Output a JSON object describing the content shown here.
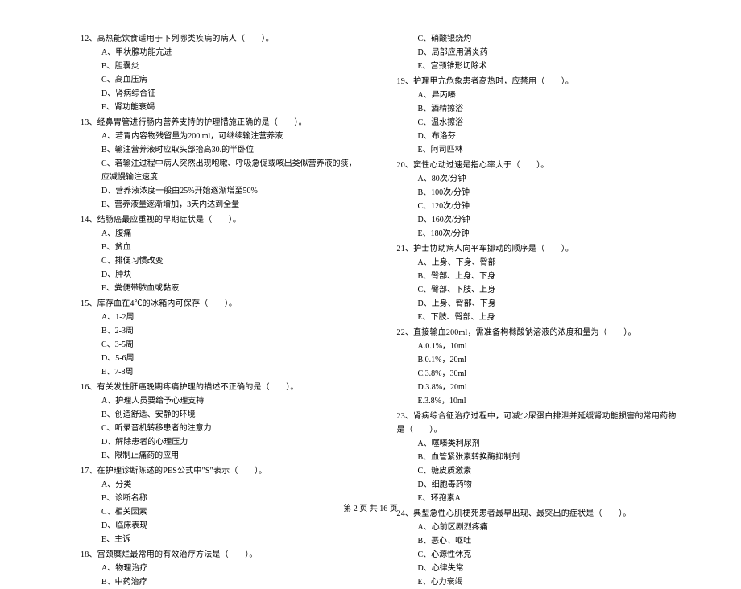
{
  "left": [
    {
      "n": "12、",
      "t": "高热能饮食适用于下列哪类疾病的病人（　　）。",
      "o": [
        "A、甲状腺功能亢进",
        "B、胆囊炎",
        "C、高血压病",
        "D、肾病综合征",
        "E、肾功能衰竭"
      ]
    },
    {
      "n": "13、",
      "t": "经鼻胃管进行肠内营养支持的护理措施正确的是（　　）。",
      "o": [
        "A、若胃内容物残留量为200 ml，可继续输注营养液",
        "B、输注营养液时应取头部抬高30.的半卧位",
        "C、若输注过程中病人突然出现咆嗽、呼吸急促或咳出类似营养液的痰，应减慢输注速度",
        "D、营养液浓度一般由25%开始逐渐增至50%",
        "E、营养液量逐渐增加，3天内达到全量"
      ]
    },
    {
      "n": "14、",
      "t": "结肠癌最应重视的早期症状是（　　）。",
      "o": [
        "A、腹痛",
        "B、贫血",
        "C、排便习惯改变",
        "D、肿块",
        "E、粪便带脓血或黏液"
      ]
    },
    {
      "n": "15、",
      "t": "库存血在4℃的冰箱内可保存（　　）。",
      "o": [
        "A、1-2周",
        "B、2-3周",
        "C、3-5周",
        "D、5-6周",
        "E、7-8周"
      ]
    },
    {
      "n": "16、",
      "t": "有关发性肝癌晚期疼痛护理的描述不正确的是（　　）。",
      "o": [
        "A、护理人员要给予心理支持",
        "B、创造舒适、安静的环境",
        "C、听录音机转移患者的注意力",
        "D、解除患者的心理压力",
        "E、限制止痛药的应用"
      ]
    },
    {
      "n": "17、",
      "t": "在护理诊断陈述的PES公式中\"S\"表示（　　）。",
      "o": [
        "A、分类",
        "B、诊断名称",
        "C、相关因素",
        "D、临床表现",
        "E、主诉"
      ]
    },
    {
      "n": "18、",
      "t": "宫颈糜烂最常用的有效治疗方法是（　　）。",
      "o": [
        "A、物理治疗",
        "B、中药治疗"
      ]
    }
  ],
  "right": [
    {
      "o": [
        "C、硝酸银烧灼",
        "D、局部应用消炎药",
        "E、宫颈锥形切除术"
      ]
    },
    {
      "n": "19、",
      "t": "护理甲亢危象患者高热时，应禁用（　　）。",
      "o": [
        "A、异丙嗪",
        "B、酒精擦浴",
        "C、温水擦浴",
        "D、布洛芬",
        "E、阿司匹林"
      ]
    },
    {
      "n": "20、",
      "t": "窦性心动过速是指心率大于（　　）。",
      "o": [
        "A、80次/分钟",
        "B、100次/分钟",
        "C、120次/分钟",
        "D、160次/分钟",
        "E、180次/分钟"
      ]
    },
    {
      "n": "21、",
      "t": "护士协助病人向平车挪动的顺序是（　　）。",
      "o": [
        "A、上身、下身、臀部",
        "B、臀部、上身、下身",
        "C、臀部、下肢、上身",
        "D、上身、臀部、下身",
        "E、下肢、臀部、上身"
      ]
    },
    {
      "n": "22、",
      "t": "直接输血200ml，需准备枸橼酸钠溶液的浓度和量为（　　）。",
      "o": [
        "A.0.1%，10ml",
        "B.0.1%，20ml",
        "C.3.8%，30ml",
        "D.3.8%，20ml",
        "E.3.8%，10ml"
      ]
    },
    {
      "n": "23、",
      "t": "肾病综合征治疗过程中，可减少尿蛋白排泄并延缓肾功能损害的常用药物是（　　）。",
      "o": [
        "A、噻嗪类利尿剂",
        "B、血管紧张素转换酶抑制剂",
        "C、糖皮质激素",
        "D、细胞毒药物",
        "E、环孢素A"
      ]
    },
    {
      "n": "24、",
      "t": "典型急性心肌梗死患者最早出现、最突出的症状是（　　）。",
      "o": [
        "A、心前区剧烈疼痛",
        "B、恶心、呕吐",
        "C、心源性休克",
        "D、心律失常",
        "E、心力衰竭"
      ]
    }
  ],
  "footer": "第 2 页 共 16 页"
}
